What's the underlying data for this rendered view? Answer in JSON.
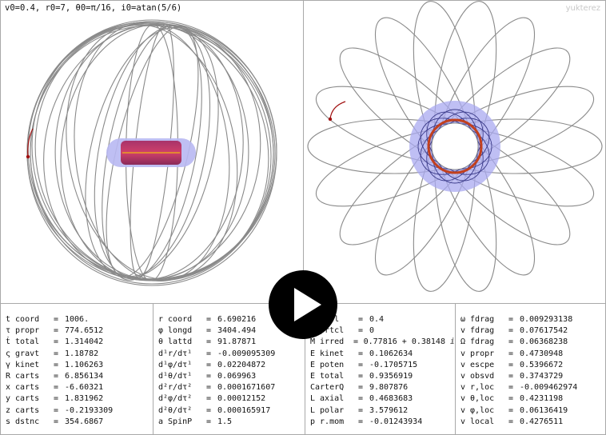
{
  "header": {
    "params": "v0=0.4, r0=7, θ0=π/16, i0=atan(5/6)",
    "watermark": "yukterez"
  },
  "colors": {
    "orbit": "#8a8a8a",
    "ergosphere": "#b9b9f2",
    "horizon": "#c0354a",
    "trail": "#a01010"
  },
  "columns": [
    [
      {
        "label": "t coord",
        "value": "1006."
      },
      {
        "label": "τ propr",
        "value": "774.6512"
      },
      {
        "label": "ṫ total",
        "value": "1.314042"
      },
      {
        "label": "ς gravt",
        "value": "1.18782"
      },
      {
        "label": "γ kinet",
        "value": "1.106263"
      },
      {
        "label": "R carts",
        "value": "6.856134"
      },
      {
        "label": "x carts",
        "value": "-6.60321"
      },
      {
        "label": "y carts",
        "value": "1.831962"
      },
      {
        "label": "z carts",
        "value": "-0.2193309"
      },
      {
        "label": "s dstnc",
        "value": "354.6867"
      }
    ],
    [
      {
        "label": "r coord",
        "value": "6.690216"
      },
      {
        "label": "φ longd",
        "value": "3404.494"
      },
      {
        "label": "θ lattd",
        "value": "91.87871"
      },
      {
        "label": "d¹r/dτ¹",
        "value": "-0.009095309"
      },
      {
        "label": "d¹φ/dτ¹",
        "value": "0.02204872"
      },
      {
        "label": "d¹θ/dτ¹",
        "value": "0.069963"
      },
      {
        "label": "d²r/dτ²",
        "value": "0.0001671607"
      },
      {
        "label": "d²φ/dτ²",
        "value": "0.00012152"
      },
      {
        "label": "d²θ/dτ²",
        "value": "0.000165917"
      },
      {
        "label": "a SpinP",
        "value": "1.5"
      }
    ],
    [
      {
        "label": "Q chrl",
        "value": "0.4"
      },
      {
        "label": "q prtcl",
        "value": "0"
      },
      {
        "label": "M irred",
        "value": "0.77816 + 0.38148 ⅈ"
      },
      {
        "label": "E kinet",
        "value": "0.1062634"
      },
      {
        "label": "E poten",
        "value": "-0.1705715"
      },
      {
        "label": "E total",
        "value": "0.9356919"
      },
      {
        "label": "CarterQ",
        "value": "9.807876"
      },
      {
        "label": "L axial",
        "value": "0.4683683"
      },
      {
        "label": "L polar",
        "value": "3.579612"
      },
      {
        "label": "p r.mom",
        "value": "-0.01243934"
      }
    ],
    [
      {
        "label": "ω fdrag",
        "value": "0.009293138"
      },
      {
        "label": "v fdrag",
        "value": "0.07617542"
      },
      {
        "label": "Ω fdrag",
        "value": "0.06368238"
      },
      {
        "label": "v propr",
        "value": "0.4730948"
      },
      {
        "label": "v escpe",
        "value": "0.5396672"
      },
      {
        "label": "v obsvd",
        "value": "0.3743729"
      },
      {
        "label": "v r,loc",
        "value": "-0.009462974"
      },
      {
        "label": "v θ,loc",
        "value": "0.4231198"
      },
      {
        "label": "v φ,loc",
        "value": "0.06136419"
      },
      {
        "label": "v local",
        "value": "0.4276511"
      }
    ]
  ]
}
